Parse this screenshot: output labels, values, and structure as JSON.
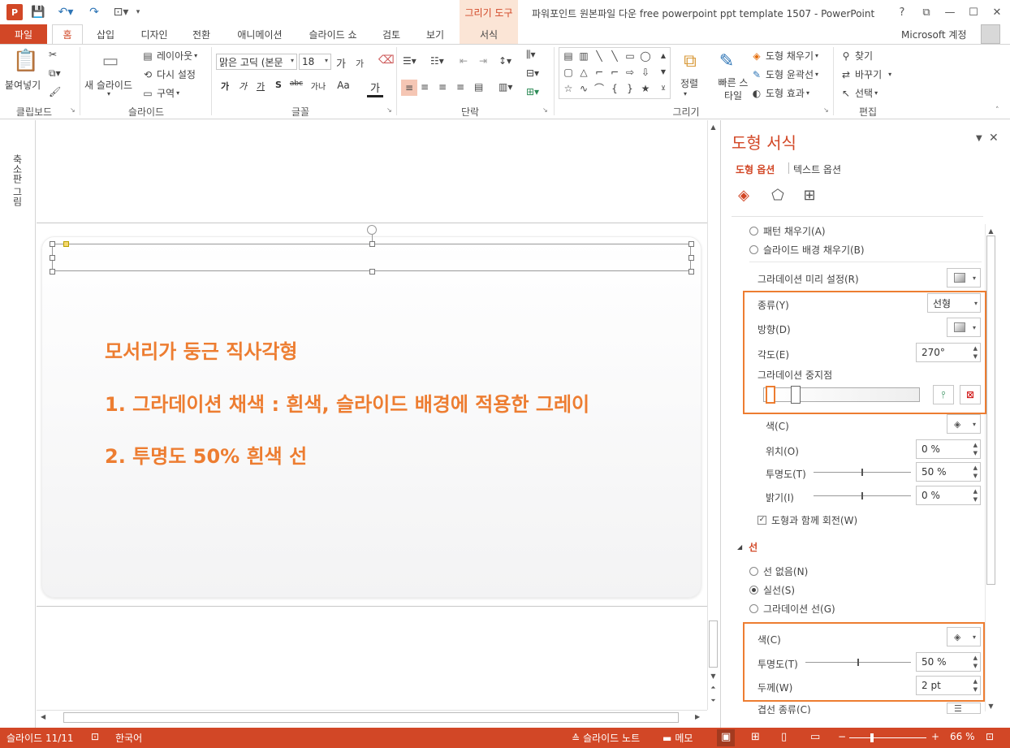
{
  "window": {
    "title": "파워포인트 원본파일 다운 free powerpoint ppt template 1507 - PowerPoint",
    "context_tab_title": "그리기 도구",
    "help": "?",
    "min": "—",
    "max": "☐",
    "close": "✕",
    "account": "Microsoft 계정"
  },
  "tabs": {
    "file": "파일",
    "home": "홈",
    "insert": "삽입",
    "design": "디자인",
    "transitions": "전환",
    "animations": "애니메이션",
    "slideshow": "슬라이드 쇼",
    "review": "검토",
    "view": "보기",
    "format": "서식"
  },
  "ribbon": {
    "clipboard": {
      "paste": "붙여넣기",
      "label": "클립보드"
    },
    "slides": {
      "new_slide": "새 슬라이드",
      "layout": "레이아웃",
      "reset": "다시 설정",
      "section": "구역",
      "label": "슬라이드"
    },
    "font": {
      "font_name": "맑은 고딕 (본문",
      "font_size": "18",
      "grow": "가",
      "shrink": "가",
      "bold": "가",
      "italic": "가",
      "underline": "가",
      "shadow": "S",
      "strike": "abc",
      "spacing": "가나",
      "case": "Aa",
      "color": "가",
      "label": "글꼴"
    },
    "paragraph": {
      "label": "단락"
    },
    "drawing": {
      "arrange": "정렬",
      "quick_styles": "빠른 스타일",
      "fill": "도형 채우기",
      "outline": "도형 윤곽선",
      "effects": "도형 효과",
      "label": "그리기"
    },
    "editing": {
      "find": "찾기",
      "replace": "바꾸기",
      "select": "선택",
      "label": "편집"
    }
  },
  "thumbnails": {
    "label": "축소판 그림"
  },
  "slide": {
    "heading": "모서리가 둥근 직사각형",
    "line1": "1. 그라데이션 채색 : 흰색, 슬라이드 배경에 적용한 그레이",
    "line2": "2. 투명도 50% 흰색 선"
  },
  "format_pane": {
    "title": "도형 서식",
    "tab_shape": "도형 옵션",
    "tab_text": "텍스트 옵션",
    "pattern_fill": "패턴 채우기(A)",
    "slide_bg_fill": "슬라이드 배경 채우기(B)",
    "gradient_preset": "그라데이션 미리 설정(R)",
    "type_label": "종류(Y)",
    "type_value": "선형",
    "direction_label": "방향(D)",
    "angle_label": "각도(E)",
    "angle_value": "270°",
    "stops_label": "그라데이션 중지점",
    "color_label": "색(C)",
    "position_label": "위치(O)",
    "position_value": "0 %",
    "transparency_label": "투명도(T)",
    "transparency_value": "50 %",
    "transparency_level": 0.5,
    "brightness_label": "밝기(I)",
    "brightness_value": "0 %",
    "rotate_with_shape": "도형과 함께 회전(W)",
    "line_section": "선",
    "no_line": "선 없음(N)",
    "solid_line": "실선(S)",
    "gradient_line": "그라데이션 선(G)",
    "line_color_label": "색(C)",
    "line_transparency_label": "투명도(T)",
    "line_transparency_value": "50 %",
    "line_transparency_level": 0.5,
    "width_label": "두께(W)",
    "width_value": "2 pt",
    "compound_label": "겹선 종류(C)"
  },
  "statusbar": {
    "slide_info": "슬라이드 11/11",
    "language": "한국어",
    "notes": "슬라이드 노트",
    "comments": "메모",
    "zoom": "66 %"
  },
  "colors": {
    "accent": "#d24726",
    "highlight": "#ed7d31"
  }
}
